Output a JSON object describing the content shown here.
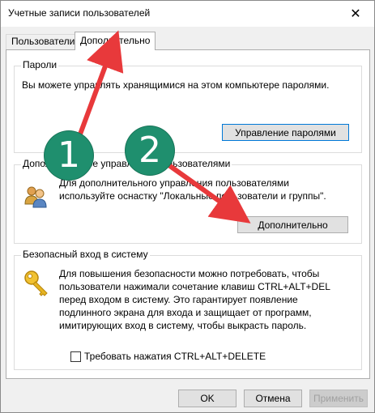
{
  "window": {
    "title": "Учетные записи пользователей",
    "close_glyph": "✕"
  },
  "tabs": [
    {
      "label": "Пользователи"
    },
    {
      "label": "Дополнительно"
    }
  ],
  "passwords": {
    "title": "Пароли",
    "text": "Вы можете управлять хранящимися на этом компьютере паролями.",
    "button": "Управление паролями"
  },
  "advanced_management": {
    "title": "Дополнительное управление пользователями",
    "text_line1": "Для дополнительного управления пользователями",
    "text_line2": "используйте оснастку \"Локальные пользователи и группы\".",
    "button": "Дополнительно",
    "icon": "users-icon"
  },
  "secure_logon": {
    "title": "Безопасный вход в систему",
    "lines": [
      "Для повышения безопасности можно потребовать, чтобы",
      "пользователи нажимали сочетание клавиш CTRL+ALT+DEL",
      "перед входом в систему. Это гарантирует появление",
      "подлинного экрана для входа и защищает от программ,",
      "имитирующих вход в систему, чтобы выкрасть пароль."
    ],
    "checkbox_label": "Требовать нажатия CTRL+ALT+DELETE",
    "checkbox_checked": false,
    "icon": "key-icon"
  },
  "footer": {
    "ok": "OK",
    "cancel": "Отмена",
    "apply": "Применить"
  },
  "annotations": {
    "badge1": "1",
    "badge2": "2",
    "arrow_color": "#e8393b",
    "badge_color": "#1f8f6e"
  }
}
